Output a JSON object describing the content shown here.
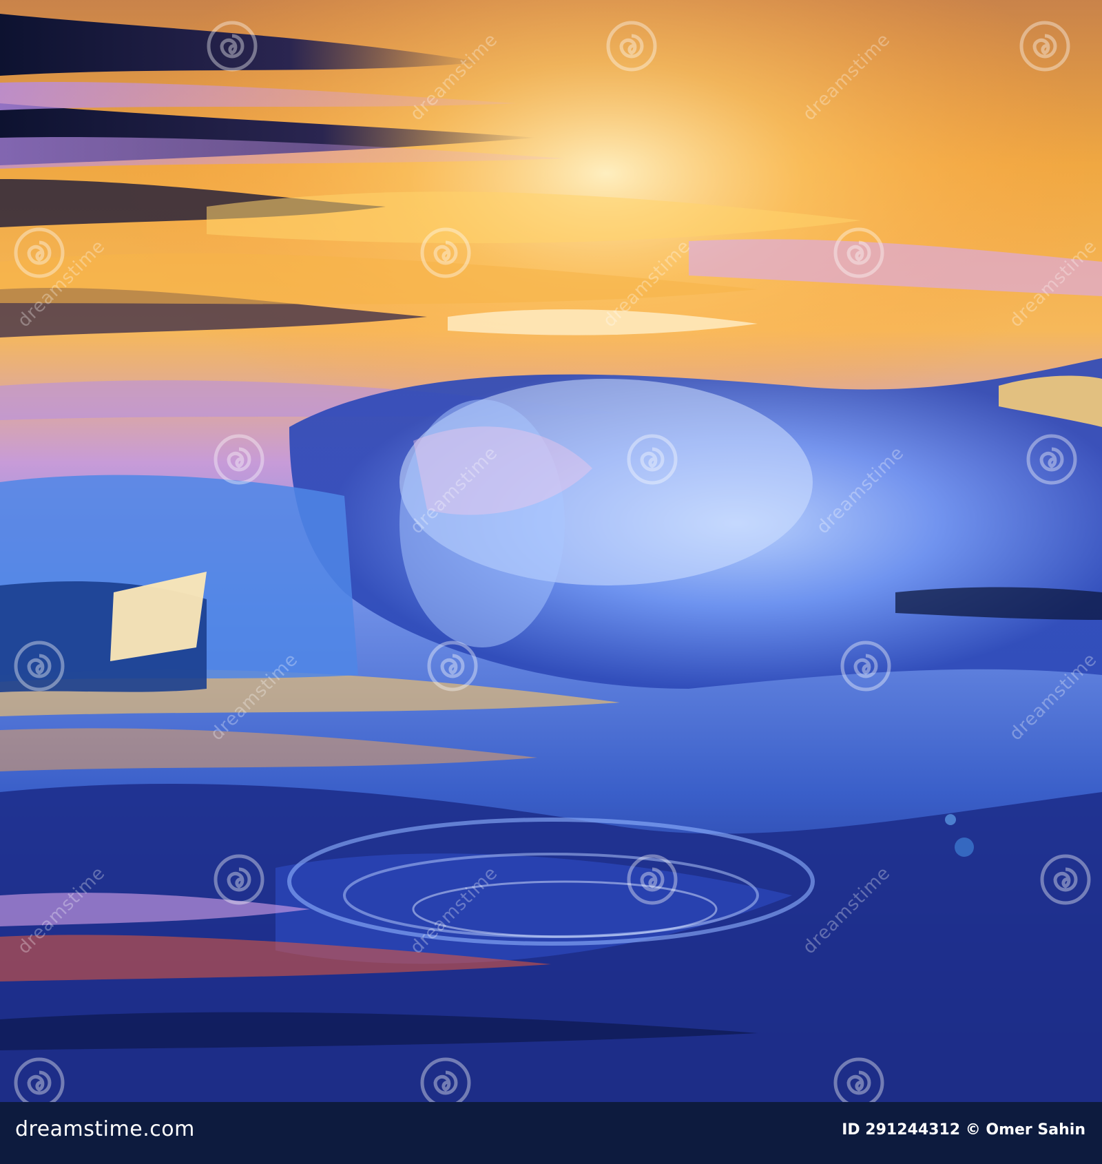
{
  "image": {
    "description_colors": {
      "sky_orange": "#f3a33b",
      "sky_gold": "#ffd37a",
      "wave_blue": "#3a6fd8",
      "deep_blue": "#1a2a7a",
      "violet": "#a889e0",
      "highlight": "#fff4d6"
    }
  },
  "watermark": {
    "text": "dreamstime",
    "icon": "spiral-icon"
  },
  "footer": {
    "brand": "dreamstime.com",
    "credit": "ID 291244312 © Omer Sahin",
    "background": "#0d1b3e"
  }
}
